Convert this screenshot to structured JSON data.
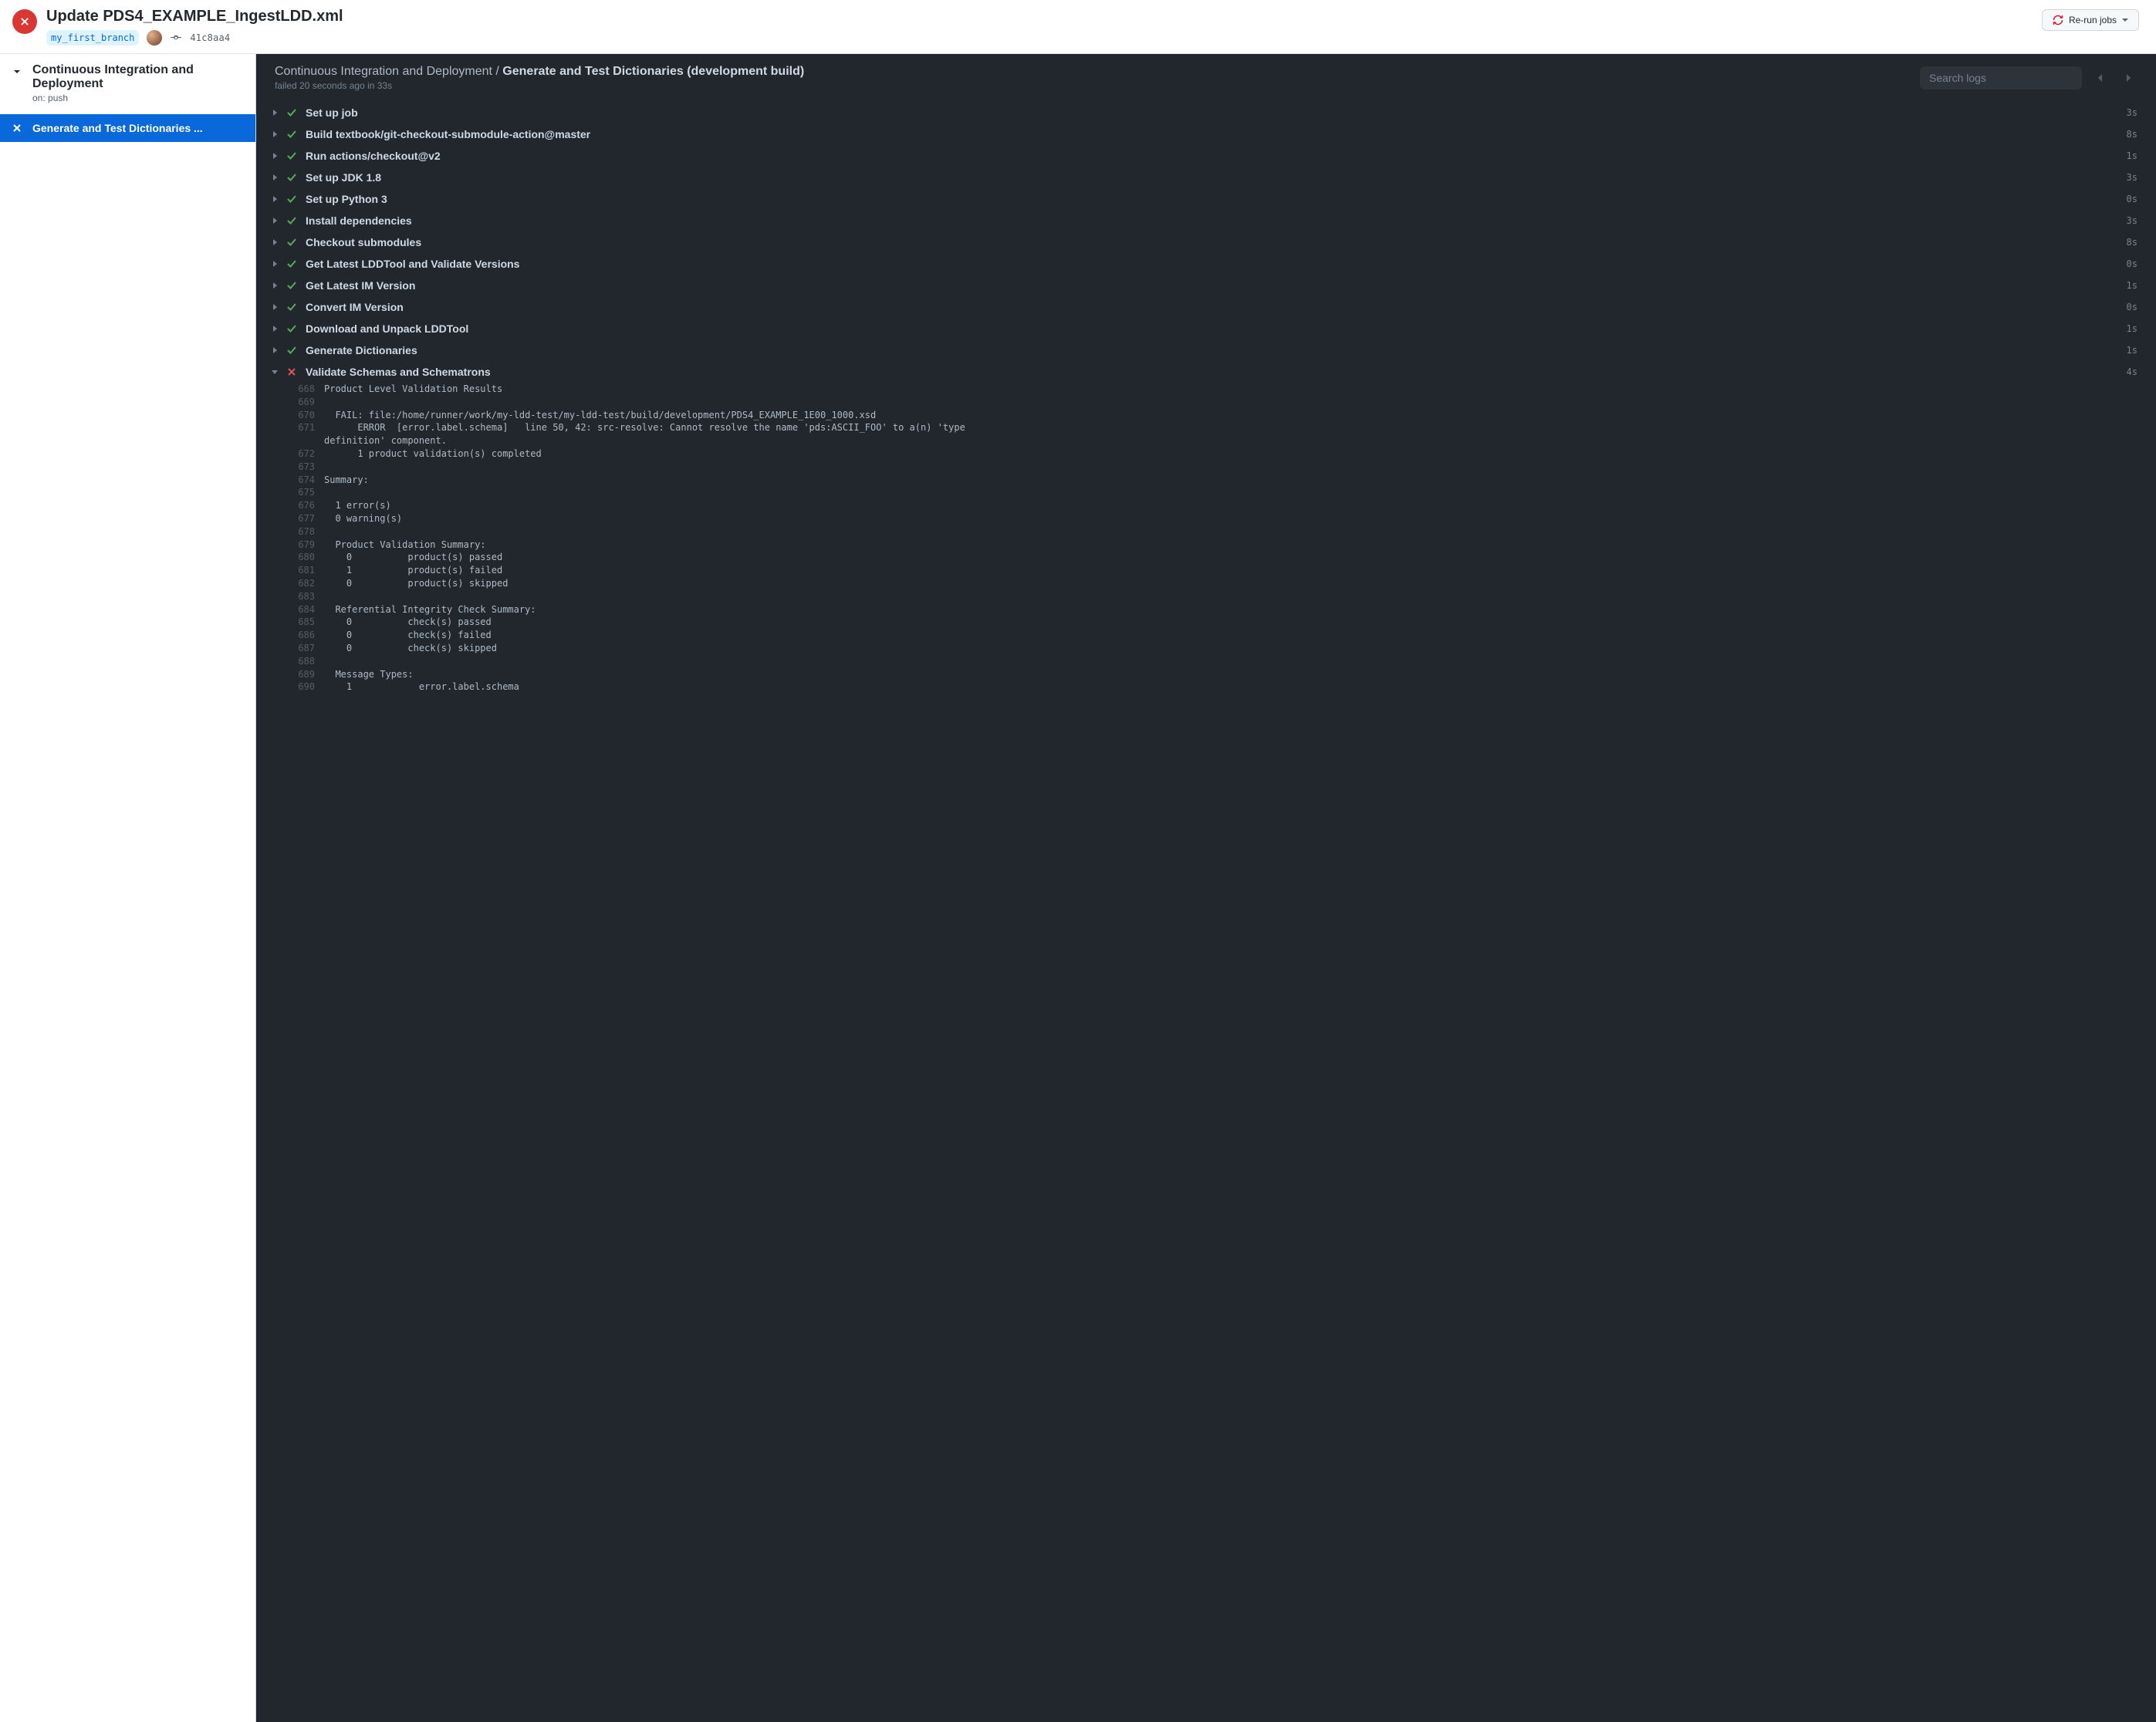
{
  "header": {
    "title": "Update PDS4_EXAMPLE_IngestLDD.xml",
    "branch": "my_first_branch",
    "sha": "41c8aa4",
    "rerun_label": "Re-run jobs"
  },
  "sidebar": {
    "workflow_name": "Continuous Integration and Deployment",
    "workflow_event": "on: push",
    "selected_job": "Generate and Test Dictionaries ..."
  },
  "log_header": {
    "breadcrumb_prefix": "Continuous Integration and Deployment / ",
    "breadcrumb_current": "Generate and Test Dictionaries (development build)",
    "status": "failed 20 seconds ago in 33s",
    "search_placeholder": "Search logs"
  },
  "steps": [
    {
      "label": "Set up job",
      "time": "3s",
      "status": "success",
      "expanded": false
    },
    {
      "label": "Build textbook/git-checkout-submodule-action@master",
      "time": "8s",
      "status": "success",
      "expanded": false
    },
    {
      "label": "Run actions/checkout@v2",
      "time": "1s",
      "status": "success",
      "expanded": false
    },
    {
      "label": "Set up JDK 1.8",
      "time": "3s",
      "status": "success",
      "expanded": false
    },
    {
      "label": "Set up Python 3",
      "time": "0s",
      "status": "success",
      "expanded": false
    },
    {
      "label": "Install dependencies",
      "time": "3s",
      "status": "success",
      "expanded": false
    },
    {
      "label": "Checkout submodules",
      "time": "8s",
      "status": "success",
      "expanded": false
    },
    {
      "label": "Get Latest LDDTool and Validate Versions",
      "time": "0s",
      "status": "success",
      "expanded": false
    },
    {
      "label": "Get Latest IM Version",
      "time": "1s",
      "status": "success",
      "expanded": false
    },
    {
      "label": "Convert IM Version",
      "time": "0s",
      "status": "success",
      "expanded": false
    },
    {
      "label": "Download and Unpack LDDTool",
      "time": "1s",
      "status": "success",
      "expanded": false
    },
    {
      "label": "Generate Dictionaries",
      "time": "1s",
      "status": "success",
      "expanded": false
    },
    {
      "label": "Validate Schemas and Schematrons",
      "time": "4s",
      "status": "failure",
      "expanded": true
    }
  ],
  "log_lines": [
    {
      "n": "668",
      "t": "Product Level Validation Results"
    },
    {
      "n": "669",
      "t": ""
    },
    {
      "n": "670",
      "t": "  FAIL: file:/home/runner/work/my-ldd-test/my-ldd-test/build/development/PDS4_EXAMPLE_1E00_1000.xsd"
    },
    {
      "n": "671",
      "t": "      ERROR  [error.label.schema]   line 50, 42: src-resolve: Cannot resolve the name 'pds:ASCII_FOO' to a(n) 'type\ndefinition' component."
    },
    {
      "n": "672",
      "t": "      1 product validation(s) completed"
    },
    {
      "n": "673",
      "t": ""
    },
    {
      "n": "674",
      "t": "Summary:"
    },
    {
      "n": "675",
      "t": ""
    },
    {
      "n": "676",
      "t": "  1 error(s)"
    },
    {
      "n": "677",
      "t": "  0 warning(s)"
    },
    {
      "n": "678",
      "t": ""
    },
    {
      "n": "679",
      "t": "  Product Validation Summary:"
    },
    {
      "n": "680",
      "t": "    0          product(s) passed"
    },
    {
      "n": "681",
      "t": "    1          product(s) failed"
    },
    {
      "n": "682",
      "t": "    0          product(s) skipped"
    },
    {
      "n": "683",
      "t": ""
    },
    {
      "n": "684",
      "t": "  Referential Integrity Check Summary:"
    },
    {
      "n": "685",
      "t": "    0          check(s) passed"
    },
    {
      "n": "686",
      "t": "    0          check(s) failed"
    },
    {
      "n": "687",
      "t": "    0          check(s) skipped"
    },
    {
      "n": "688",
      "t": ""
    },
    {
      "n": "689",
      "t": "  Message Types:"
    },
    {
      "n": "690",
      "t": "    1            error.label.schema"
    }
  ]
}
